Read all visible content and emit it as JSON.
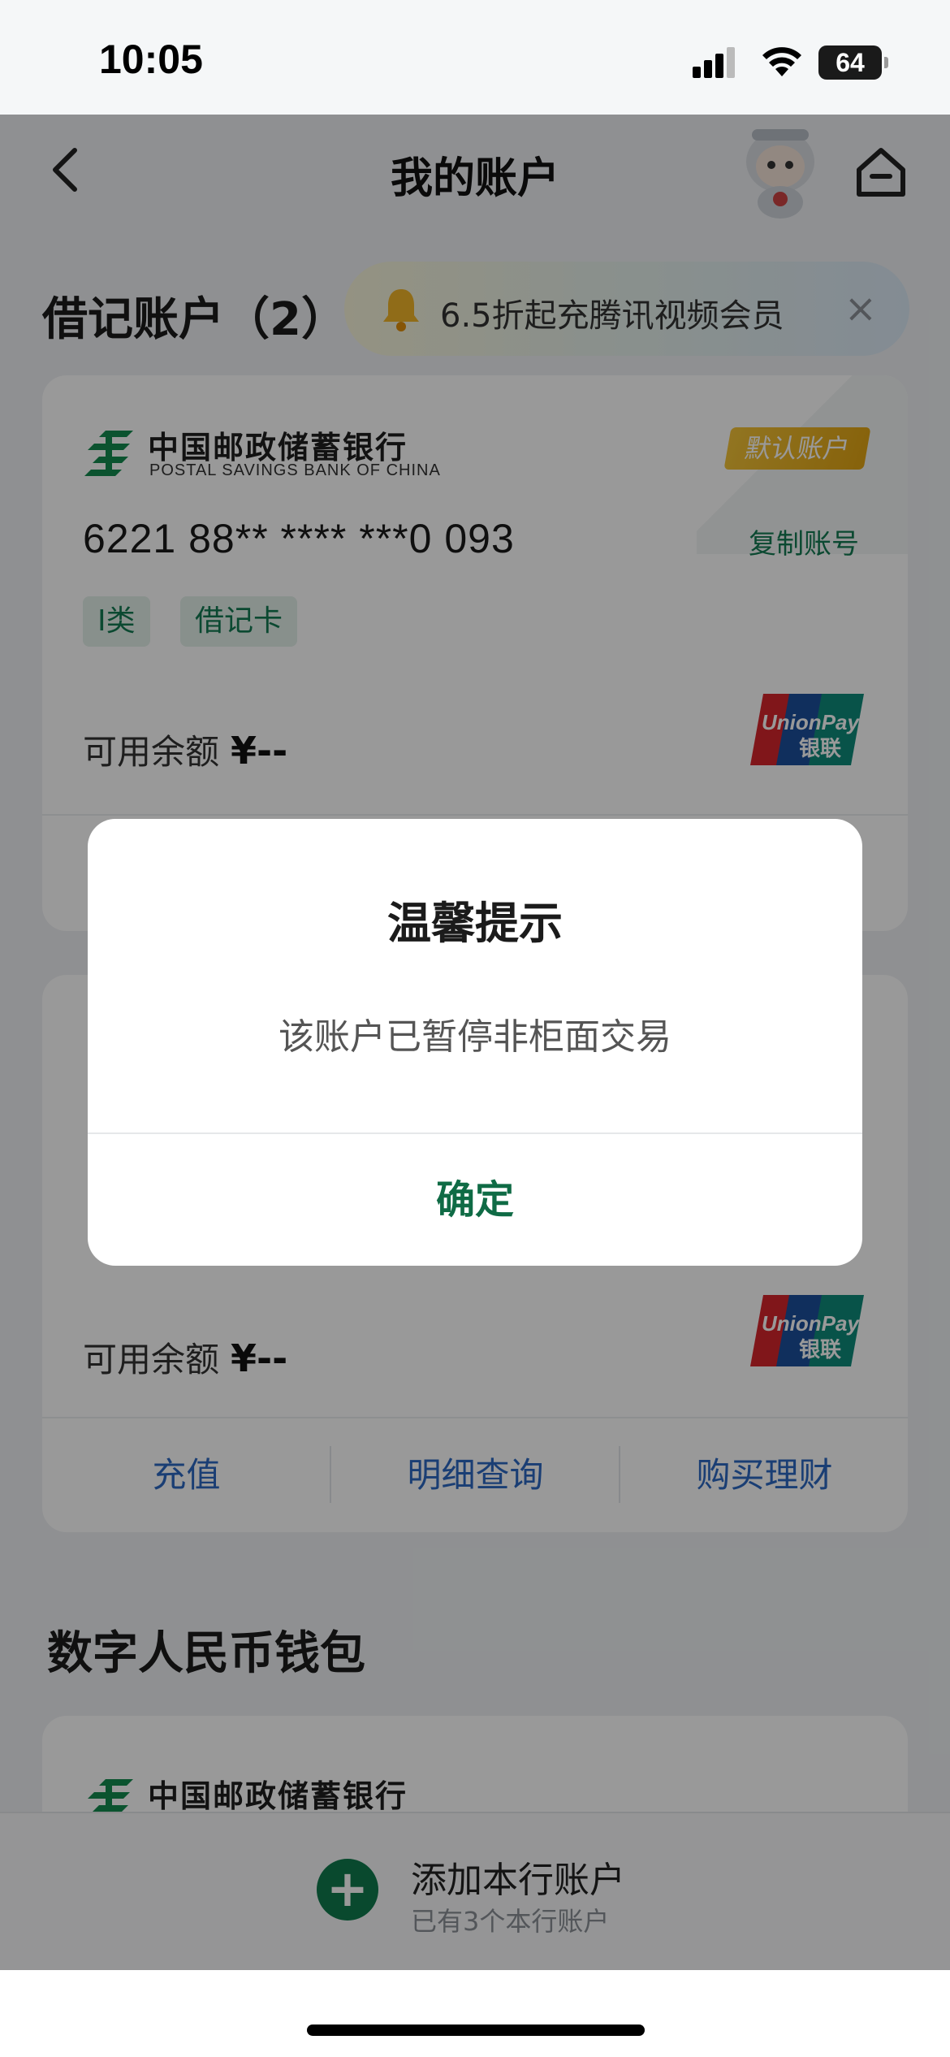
{
  "status_bar": {
    "time": "10:05",
    "battery": "64"
  },
  "nav": {
    "title": "我的账户"
  },
  "debit_section": {
    "title": "借记账户（2）"
  },
  "promo": {
    "text": "6.5折起充腾讯视频会员",
    "close": "×"
  },
  "card1": {
    "bank_name_cn": "中国邮政储蓄银行",
    "bank_name_en": "POSTAL SAVINGS BANK OF CHINA",
    "badge": "默认账户",
    "number": "6221 88** **** ***0 093",
    "copy": "复制账号",
    "tags": [
      "I类",
      "借记卡"
    ],
    "balance_label": "可用余额",
    "balance_value": "¥--"
  },
  "card2": {
    "balance_label": "可用余额",
    "balance_value": "¥--",
    "actions": [
      "充值",
      "明细查询",
      "购买理财"
    ]
  },
  "wallet_section": {
    "title": "数字人民币钱包",
    "bank_name_cn": "中国邮政储蓄银行"
  },
  "add_account": {
    "label": "添加本行账户",
    "sub": "已有3个本行账户"
  },
  "dialog": {
    "title": "温馨提示",
    "message": "该账户已暂停非柜面交易",
    "ok": "确定"
  },
  "colors": {
    "brand_green": "#0f7a4d",
    "action_blue": "#2c68c2",
    "badge_gold": "#e9b020"
  },
  "icons": [
    "back-icon",
    "home-icon",
    "bell-icon",
    "close-icon",
    "postal-logo-icon",
    "unionpay-logo-icon",
    "plus-icon",
    "signal-icon",
    "wifi-icon"
  ]
}
